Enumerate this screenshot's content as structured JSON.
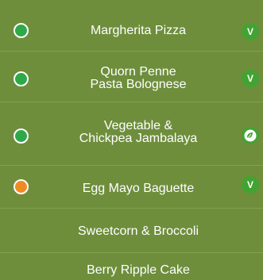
{
  "menu": {
    "items": [
      {
        "name": "Margherita Pizza",
        "status_color": "#2fa84a",
        "badge": "V",
        "badge_icon": "vegetarian-badge-icon"
      },
      {
        "name": "Quorn Penne\nPasta Bolognese",
        "status_color": "#2fa84a",
        "badge": "V",
        "badge_icon": "vegetarian-badge-icon"
      },
      {
        "name": "Vegetable &\nChickpea Jambalaya",
        "status_color": "#2fa84a",
        "badge": "",
        "badge_icon": "vegan-leaf-icon"
      },
      {
        "name": "Egg Mayo Baguette",
        "status_color": "#f08a24",
        "badge": "V",
        "badge_icon": "vegetarian-badge-icon"
      },
      {
        "name": "Sweetcorn & Broccoli"
      },
      {
        "name": "Berry Ripple Cake"
      }
    ]
  },
  "colors": {
    "background": "#6e8e3c",
    "green_status": "#2fa84a",
    "orange_status": "#f08a24",
    "badge_green": "#43a332"
  }
}
